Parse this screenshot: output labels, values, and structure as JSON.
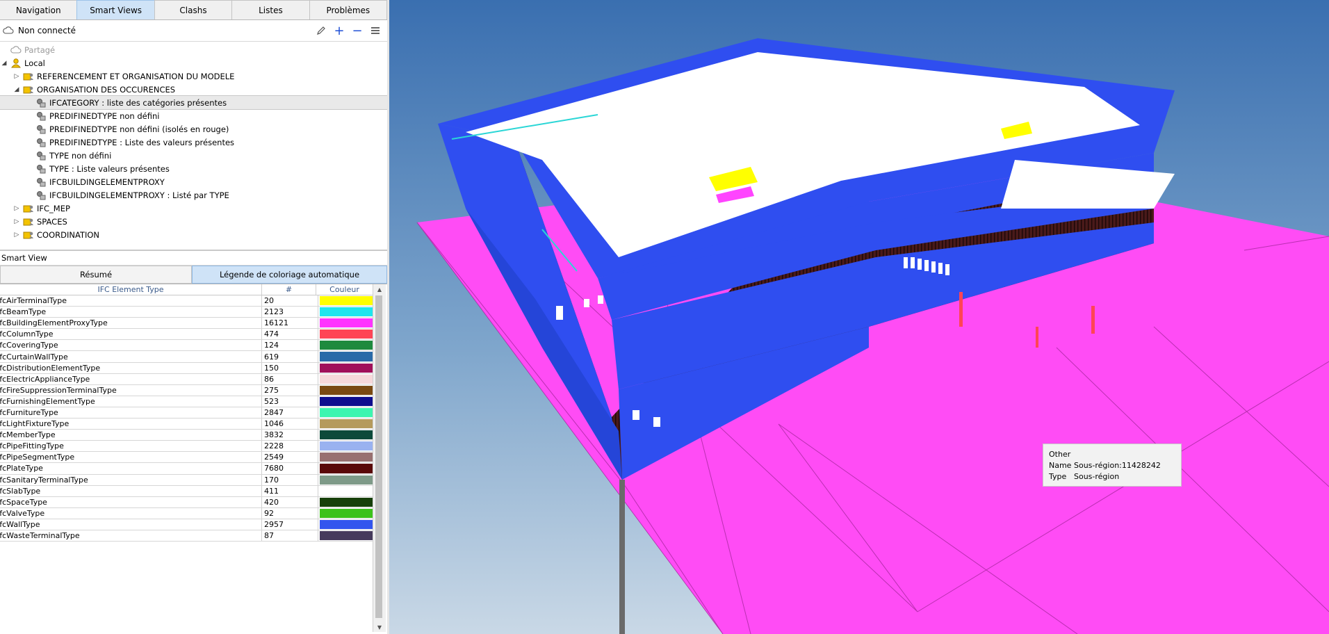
{
  "tabs": [
    {
      "label": "Navigation",
      "active": false
    },
    {
      "label": "Smart Views",
      "active": true
    },
    {
      "label": "Clashs",
      "active": false
    },
    {
      "label": "Listes",
      "active": false
    },
    {
      "label": "Problèmes",
      "active": false
    }
  ],
  "toolbar": {
    "status": "Non connecté",
    "icons": [
      "cloud-icon",
      "pencil-icon",
      "plus-icon",
      "minus-icon",
      "menu-icon"
    ]
  },
  "tree": [
    {
      "label": "Partagé",
      "level": 0,
      "expander": "",
      "icon": "cloud-icon",
      "dim": true
    },
    {
      "label": "Local",
      "level": 0,
      "expander": "expanded",
      "icon": "user-icon"
    },
    {
      "label": "REFERENCEMENT ET ORGANISATION DU MODELE",
      "level": 1,
      "expander": "collapsed",
      "icon": "folder-user-icon"
    },
    {
      "label": "ORGANISATION DES OCCURENCES",
      "level": 1,
      "expander": "expanded",
      "icon": "folder-user-icon"
    },
    {
      "label": "IFCATEGORY : liste des catégories présentes",
      "level": 2,
      "expander": "",
      "icon": "smartview-icon",
      "selected": true
    },
    {
      "label": "PREDIFINEDTYPE non défini",
      "level": 2,
      "expander": "",
      "icon": "smartview-icon"
    },
    {
      "label": "PREDIFINEDTYPE non défini (isolés en rouge)",
      "level": 2,
      "expander": "",
      "icon": "smartview-icon"
    },
    {
      "label": "PREDIFINEDTYPE : Liste des valeurs présentes",
      "level": 2,
      "expander": "",
      "icon": "smartview-icon"
    },
    {
      "label": "TYPE non défini",
      "level": 2,
      "expander": "",
      "icon": "smartview-icon"
    },
    {
      "label": "TYPE : Liste valeurs présentes",
      "level": 2,
      "expander": "",
      "icon": "smartview-icon"
    },
    {
      "label": "IFCBUILDINGELEMENTPROXY",
      "level": 2,
      "expander": "",
      "icon": "smartview-icon"
    },
    {
      "label": "IFCBUILDINGELEMENTPROXY : Listé par TYPE",
      "level": 2,
      "expander": "",
      "icon": "smartview-icon"
    },
    {
      "label": "IFC_MEP",
      "level": 1,
      "expander": "collapsed",
      "icon": "folder-user-icon"
    },
    {
      "label": "SPACES",
      "level": 1,
      "expander": "collapsed",
      "icon": "folder-user-icon"
    },
    {
      "label": "COORDINATION",
      "level": 1,
      "expander": "collapsed",
      "icon": "folder-user-icon"
    }
  ],
  "smartview": {
    "header": "Smart View",
    "tabs": [
      {
        "label": "Résumé",
        "active": false
      },
      {
        "label": "Légende de coloriage automatique",
        "active": true
      }
    ],
    "columns": [
      "IFC Element Type",
      "#",
      "Couleur"
    ],
    "rows": [
      {
        "type": "IfcAirTerminalType",
        "count": "20",
        "color": "#ffff00"
      },
      {
        "type": "IfcBeamType",
        "count": "2123",
        "color": "#1ee6ee"
      },
      {
        "type": "IfcBuildingElementProxyType",
        "count": "16121",
        "color": "#ff33ff"
      },
      {
        "type": "IfcColumnType",
        "count": "474",
        "color": "#ff4455"
      },
      {
        "type": "IfcCoveringType",
        "count": "124",
        "color": "#1e8a3e"
      },
      {
        "type": "IfcCurtainWallType",
        "count": "619",
        "color": "#2a6aa8"
      },
      {
        "type": "IfcDistributionElementType",
        "count": "150",
        "color": "#a0105a"
      },
      {
        "type": "IfcElectricApplianceType",
        "count": "86",
        "color": "#f6d8da"
      },
      {
        "type": "IfcFireSuppressionTerminalType",
        "count": "275",
        "color": "#7a4a12"
      },
      {
        "type": "IfcFurnishingElementType",
        "count": "523",
        "color": "#0e0e8e"
      },
      {
        "type": "IfcFurnitureType",
        "count": "2847",
        "color": "#3cf5b0"
      },
      {
        "type": "IfcLightFixtureType",
        "count": "1046",
        "color": "#b59a5c"
      },
      {
        "type": "IfcMemberType",
        "count": "3832",
        "color": "#0d4a3a"
      },
      {
        "type": "IfcPipeFittingType",
        "count": "2228",
        "color": "#9ab2f0"
      },
      {
        "type": "IfcPipeSegmentType",
        "count": "2549",
        "color": "#987070"
      },
      {
        "type": "IfcPlateType",
        "count": "7680",
        "color": "#5a0808"
      },
      {
        "type": "IfcSanitaryTerminalType",
        "count": "170",
        "color": "#7e9a88"
      },
      {
        "type": "IfcSlabType",
        "count": "411",
        "color": "#ffffff"
      },
      {
        "type": "IfcSpaceType",
        "count": "420",
        "color": "#17400a"
      },
      {
        "type": "IfcValveType",
        "count": "92",
        "color": "#3cc21a"
      },
      {
        "type": "IfcWallType",
        "count": "2957",
        "color": "#3355ee"
      },
      {
        "type": "IfcWasteTerminalType",
        "count": "87",
        "color": "#463a5c"
      }
    ]
  },
  "tooltip": {
    "title": "Other",
    "rows": [
      {
        "key": "Name",
        "value": "Sous-région:11428242"
      },
      {
        "key": "Type",
        "value": "Sous-région"
      }
    ]
  },
  "colors": {
    "accent": "#1f4fd6",
    "tab_active": "#cfe3f7",
    "building_wall": "#2f4ef0",
    "ground": "#ff44ff",
    "sky_top": "#3a6fb0",
    "sky_bottom": "#c9d8e6"
  }
}
